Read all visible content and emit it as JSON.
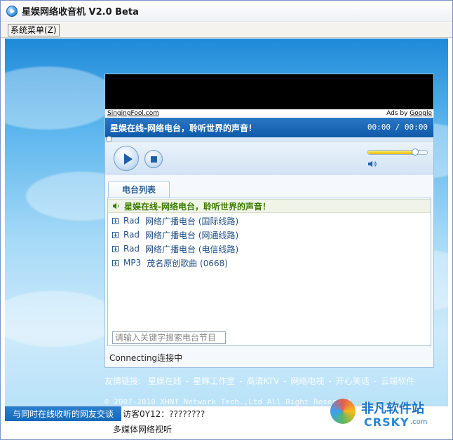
{
  "window": {
    "title": "星娱网络收音机 V2.0 Beta"
  },
  "menu": {
    "system_menu": "系统菜单(Z)"
  },
  "ad": {
    "left_link": "SingingFool.com",
    "right_prefix": "Ads by ",
    "right_link": "Google"
  },
  "player": {
    "now_playing": "星娱在线-网络电台，聆听世界的声音！",
    "time": "00:00 / 00:00",
    "volume_level": 0.8
  },
  "tabs": [
    {
      "label": "电台列表"
    }
  ],
  "station_list": [
    {
      "prefix": "",
      "label": "星娱在线-网络电台，聆听世界的声音！",
      "selected": true,
      "icon": "speaker-icon"
    },
    {
      "prefix": "Rad",
      "label": "网络广播电台 (国际线路)",
      "selected": false,
      "icon": "plus-icon"
    },
    {
      "prefix": "Rad",
      "label": "网络广播电台 (网通线路)",
      "selected": false,
      "icon": "plus-icon"
    },
    {
      "prefix": "Rad",
      "label": "网络广播电台 (电信线路)",
      "selected": false,
      "icon": "plus-icon"
    },
    {
      "prefix": "MP3",
      "label": "茂名原创歌曲 (0668)",
      "selected": false,
      "icon": "plus-icon"
    }
  ],
  "search": {
    "placeholder": "请输入关键字搜索电台节目"
  },
  "status": {
    "text": "Connecting连接中"
  },
  "friend_links": {
    "label": "友情链接:",
    "items": [
      "星娱在线",
      "星辉工作室",
      "高清KTV",
      "网络电视",
      "开心笑话",
      "云端软件"
    ]
  },
  "copyright": "© 2007-2010 XHNT Network Tech.,Ltd All Right Reserved",
  "bottom": {
    "chat_tab": "与同时在线收听的网友交谈",
    "visitor": "访客0Y12：????????",
    "video_link": "多媒体网络视听"
  },
  "watermark": {
    "line1": "非凡软件站",
    "line2": "CRSKY",
    "line3": ".com"
  }
}
